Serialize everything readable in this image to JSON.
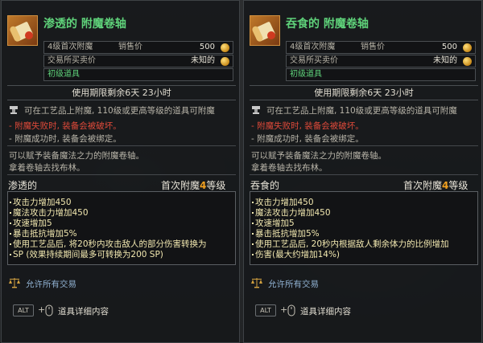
{
  "panels": [
    {
      "id": "left",
      "title": "渗透的 附魔卷轴",
      "row1_label": "4级首次附魔",
      "row1_label2": "销售价",
      "row1_value": "500",
      "row2_label": "交易所买卖价",
      "row2_value": "未知的",
      "grade": "初级道具",
      "period": "使用期限剩余6天 23小时",
      "desc1": "可在工艺品上附魔, 110级或更高等级的道具可附魔",
      "fail_text": "- 附魔失败时, 装备会被破坏。",
      "success_text": "- 附魔成功时, 装备会被绑定。",
      "info1": "可以赋予装备魔法之力的附魔卷轴。",
      "info2": "拿着卷轴去找布林。",
      "effect_name": "渗透的",
      "first_enchant_prefix": "首次附魔",
      "first_enchant_level": "4",
      "first_enchant_suffix": "等级",
      "stats": [
        "攻击力增加450",
        "魔法攻击力增加450",
        "攻速增加5",
        "暴击抵抗增加5%",
        "使用工艺品后, 将20秒内攻击敌人的部分伤害转换为",
        "SP (效果持续期间最多可转换为200 SP)"
      ],
      "trade": "允许所有交易",
      "alt_key": "ALT",
      "plus": "+",
      "detail": "道具详细内容"
    },
    {
      "id": "right",
      "title": "吞食的 附魔卷轴",
      "row1_label": "4级首次附魔",
      "row1_label2": "销售价",
      "row1_value": "500",
      "row2_label": "交易所买卖价",
      "row2_value": "未知的",
      "grade": "初级道具",
      "period": "使用期限剩余6天 23小时",
      "desc1": "可在工艺品上附魔, 110级或更高等级的道具可附魔",
      "fail_text": "- 附魔失败时, 装备会被破坏。",
      "success_text": "- 附魔成功时, 装备会被绑定。",
      "info1": "可以赋予装备魔法之力的附魔卷轴。",
      "info2": "拿着卷轴去找布林。",
      "effect_name": "吞食的",
      "first_enchant_prefix": "首次附魔",
      "first_enchant_level": "4",
      "first_enchant_suffix": "等级",
      "stats": [
        "攻击力增加450",
        "魔法攻击力增加450",
        "攻速增加5",
        "暴击抵抗增加5%",
        "使用工艺品后, 20秒内根据敌人剩余体力的比例增加",
        "伤害(最大约增加14%)"
      ],
      "trade": "允许所有交易",
      "alt_key": "ALT",
      "plus": "+",
      "detail": "道具详细内容"
    }
  ],
  "colors": {
    "title": "#5fd27a",
    "fail": "#e04a3a",
    "stat": "#f2e8b0",
    "level": "#f0a020",
    "trade": "#8fb0d0"
  }
}
